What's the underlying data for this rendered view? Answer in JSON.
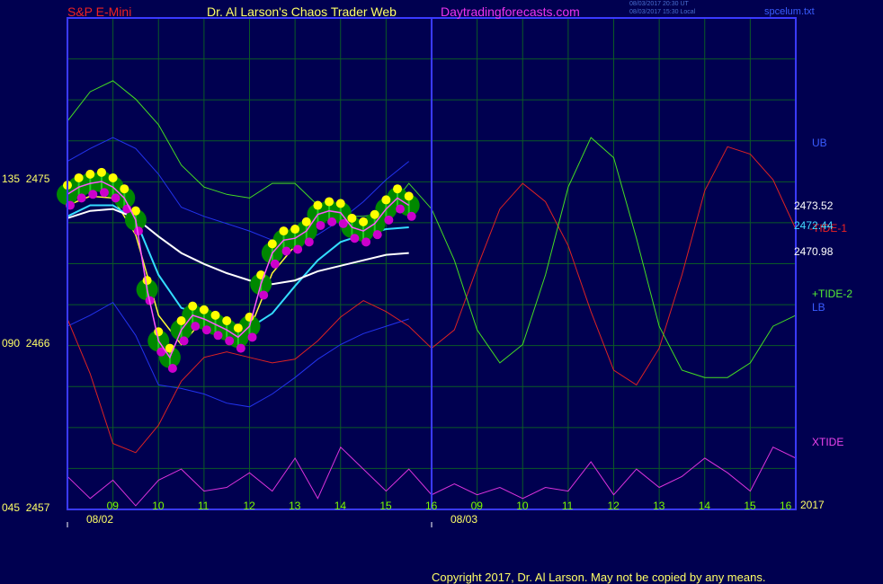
{
  "header": {
    "symbol": "S&P E-Mini",
    "title": "Dr. Al Larson's Chaos Trader Web",
    "site": "Daytradingforecasts.com",
    "timestamp_ut": "08/03/2017 20:30 UT",
    "timestamp_local": "08/03/2017 15:30 Local",
    "file": "spcelum.txt"
  },
  "y_axis": {
    "labels": [
      {
        "code": "135",
        "price": "2475"
      },
      {
        "code": "090",
        "price": "2466"
      },
      {
        "code": "045",
        "price": "2457"
      }
    ]
  },
  "x_axis": {
    "day1_hours": [
      "09",
      "10",
      "11",
      "12",
      "13",
      "14",
      "15",
      "16"
    ],
    "day2_hours": [
      "09",
      "10",
      "11",
      "12",
      "13",
      "14",
      "15",
      "16"
    ],
    "day1_date": "08/02",
    "day2_date": "08/03",
    "year": "2017"
  },
  "right_labels": {
    "ub": "UB",
    "price1": "2473.52",
    "price2": "2472.44",
    "tide1": "-TIDE-1",
    "price3": "2470.98",
    "tide2": "+TIDE-2",
    "lb": "LB",
    "xtide": "XTIDE"
  },
  "footer": {
    "copyright": "Copyright 2017, Dr. Al Larson. May not be copied by any means."
  },
  "colors": {
    "background": "#000050",
    "grid": "#0b5a26",
    "frame": "#3a3aff",
    "price_bar": "#22cc22",
    "highs": "#ffff00",
    "lows": "#cc00cc",
    "green_field": "#008800",
    "yellow_ma": "#ffff33",
    "magenta_ma": "#ff55ff",
    "cyan_ma": "#33ddff",
    "white_ma": "#ffffff",
    "upper_band": "#2233ee",
    "lower_band": "#2233ee",
    "tide1": "#dd2222",
    "tide2": "#44dd22",
    "xtide": "#dd33dd"
  },
  "chart_data": {
    "type": "line",
    "title": "S&P E-Mini",
    "x": [
      "08/02 09",
      "08/02 10",
      "08/02 11",
      "08/02 12",
      "08/02 13",
      "08/02 14",
      "08/02 15",
      "08/02 16",
      "08/03 09",
      "08/03 10",
      "08/03 11",
      "08/03 12",
      "08/03 13",
      "08/03 14",
      "08/03 15",
      "08/03 16"
    ],
    "ylim": [
      2457,
      2475
    ],
    "y_ticks": [
      2475,
      2466,
      2457
    ],
    "x_range": [
      0,
      16
    ],
    "series": [
      {
        "name": "price",
        "x": [
          0,
          0.25,
          0.5,
          0.75,
          1,
          1.25,
          1.5,
          1.75,
          2,
          2.25,
          2.5,
          2.75,
          3,
          3.25,
          3.5,
          3.75,
          4,
          4.25,
          4.5,
          4.75,
          5,
          5.25,
          5.5,
          5.75,
          6,
          6.25,
          6.5,
          6.75,
          7,
          7.25,
          7.5
        ],
        "values": [
          2474.2,
          2474.6,
          2474.8,
          2474.9,
          2474.6,
          2474.0,
          2472.8,
          2469.0,
          2466.2,
          2465.3,
          2466.8,
          2467.6,
          2467.4,
          2467.1,
          2466.8,
          2466.4,
          2467.0,
          2469.3,
          2471.0,
          2471.7,
          2471.8,
          2472.2,
          2473.1,
          2473.3,
          2473.2,
          2472.4,
          2472.2,
          2472.6,
          2473.4,
          2474.0,
          2473.6
        ]
      },
      {
        "name": "yellow",
        "x": [
          0,
          0.5,
          1,
          1.5,
          2,
          2.5,
          3,
          3.5,
          4,
          4.5,
          5,
          5.5,
          6,
          6.5,
          7,
          7.5
        ],
        "values": [
          2473.6,
          2474.1,
          2474.0,
          2472.0,
          2467.6,
          2466.0,
          2467.4,
          2466.9,
          2466.8,
          2469.9,
          2471.4,
          2472.8,
          2472.8,
          2472.3,
          2473.0,
          2473.6
        ]
      },
      {
        "name": "cyan",
        "x": [
          0,
          0.5,
          1,
          1.5,
          2,
          2.5,
          3,
          3.5,
          4,
          4.5,
          5,
          5.5,
          6,
          6.5,
          7,
          7.5
        ],
        "values": [
          2473.0,
          2473.6,
          2473.6,
          2472.8,
          2469.8,
          2468.0,
          2467.6,
          2467.2,
          2466.9,
          2467.7,
          2469.2,
          2470.6,
          2471.6,
          2472.0,
          2472.3,
          2472.4
        ]
      },
      {
        "name": "white",
        "x": [
          0,
          0.5,
          1,
          1.5,
          2,
          2.5,
          3,
          3.5,
          4,
          4.5,
          5,
          5.5,
          6,
          6.5,
          7,
          7.5
        ],
        "values": [
          2472.9,
          2473.3,
          2473.4,
          2472.9,
          2471.9,
          2471.0,
          2470.4,
          2469.9,
          2469.5,
          2469.3,
          2469.5,
          2470.0,
          2470.3,
          2470.6,
          2470.9,
          2471.0
        ]
      },
      {
        "name": "UB",
        "x": [
          0,
          0.5,
          1,
          1.5,
          2,
          2.5,
          3,
          3.5,
          4,
          4.5,
          5,
          5.5,
          6,
          6.5,
          7,
          7.5
        ],
        "values": [
          2476.0,
          2476.7,
          2477.3,
          2476.7,
          2475.3,
          2473.5,
          2473.0,
          2472.6,
          2472.2,
          2471.7,
          2471.5,
          2472.0,
          2472.8,
          2473.8,
          2475.0,
          2476.0
        ]
      },
      {
        "name": "LB",
        "x": [
          0,
          0.5,
          1,
          1.5,
          2,
          2.5,
          3,
          3.5,
          4,
          4.5,
          5,
          5.5,
          6,
          6.5,
          7,
          7.5
        ],
        "values": [
          2467.0,
          2467.6,
          2468.3,
          2466.5,
          2463.8,
          2463.6,
          2463.3,
          2462.8,
          2462.6,
          2463.3,
          2464.2,
          2465.2,
          2466.0,
          2466.6,
          2467.0,
          2467.4
        ]
      },
      {
        "name": "-TIDE-1",
        "x": [
          0,
          0.5,
          1,
          1.5,
          2,
          2.5,
          3,
          3.5,
          4,
          4.5,
          5,
          5.5,
          6,
          6.5,
          7,
          7.5,
          8,
          8.5,
          9,
          9.5,
          10,
          10.5,
          11,
          11.5,
          12,
          12.5,
          13,
          13.5,
          14,
          14.5,
          15,
          15.5,
          16
        ],
        "values": [
          2467.4,
          2464.4,
          2460.6,
          2460.1,
          2461.6,
          2464.0,
          2465.3,
          2465.6,
          2465.3,
          2465.0,
          2465.2,
          2466.2,
          2467.5,
          2468.4,
          2467.8,
          2467.0,
          2465.8,
          2466.8,
          2470.2,
          2473.4,
          2474.8,
          2473.8,
          2471.4,
          2467.8,
          2464.6,
          2463.8,
          2465.8,
          2469.8,
          2474.4,
          2476.8,
          2476.4,
          2475.0,
          2472.3
        ]
      },
      {
        "name": "+TIDE-2",
        "x": [
          0,
          0.5,
          1,
          1.5,
          2,
          2.5,
          3,
          3.5,
          4,
          4.5,
          5,
          5.5,
          6,
          6.5,
          7,
          7.5,
          8,
          8.5,
          9,
          9.5,
          10,
          10.5,
          11,
          11.5,
          12,
          12.5,
          13,
          13.5,
          14,
          14.5,
          15,
          15.5,
          16
        ],
        "values": [
          2478.2,
          2479.8,
          2480.4,
          2479.4,
          2478.0,
          2475.8,
          2474.6,
          2474.2,
          2474.0,
          2474.8,
          2474.8,
          2473.6,
          2473.0,
          2473.0,
          2473.2,
          2474.8,
          2473.4,
          2470.6,
          2466.8,
          2465.0,
          2466.0,
          2469.8,
          2474.6,
          2477.3,
          2476.2,
          2471.8,
          2467.0,
          2464.6,
          2464.2,
          2464.2,
          2465.0,
          2467.0,
          2467.6
        ]
      },
      {
        "name": "XTIDE",
        "x": [
          0,
          0.5,
          1,
          1.5,
          2,
          2.5,
          3,
          3.5,
          4,
          4.5,
          5,
          5.5,
          6,
          6.5,
          7,
          7.5,
          8,
          8.5,
          9,
          9.5,
          10,
          10.5,
          11,
          11.5,
          12,
          12.5,
          13,
          13.5,
          14,
          14.5,
          15,
          15.5,
          16
        ],
        "values": [
          2458.8,
          2457.6,
          2458.6,
          2457.2,
          2458.6,
          2459.2,
          2458.0,
          2458.2,
          2459.0,
          2458.0,
          2459.8,
          2457.6,
          2460.4,
          2459.2,
          2458.0,
          2459.2,
          2457.8,
          2458.4,
          2457.8,
          2458.2,
          2457.6,
          2458.2,
          2458.0,
          2459.6,
          2457.8,
          2459.2,
          2458.2,
          2458.8,
          2459.8,
          2459.0,
          2458.0,
          2460.4,
          2459.8
        ]
      }
    ]
  }
}
